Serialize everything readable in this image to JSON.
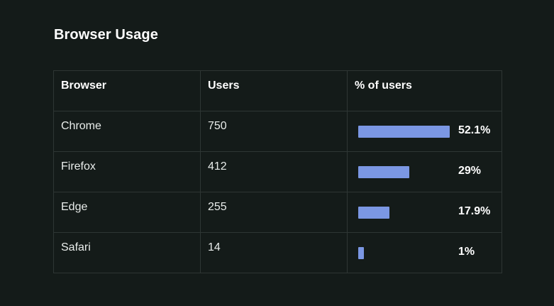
{
  "title": "Browser Usage",
  "table": {
    "headers": [
      "Browser",
      "Users",
      "% of users"
    ],
    "rows": [
      {
        "browser": "Chrome",
        "users": "750",
        "percent_label": "52.1%",
        "percent": 52.1
      },
      {
        "browser": "Firefox",
        "users": "412",
        "percent_label": "29%",
        "percent": 29
      },
      {
        "browser": "Edge",
        "users": "255",
        "percent_label": "17.9%",
        "percent": 17.9
      },
      {
        "browser": "Safari",
        "users": "14",
        "percent_label": "1%",
        "percent": 1
      }
    ]
  },
  "colors": {
    "background": "#141b19",
    "bar": "#7b97e3",
    "border": "#2e3634"
  }
}
